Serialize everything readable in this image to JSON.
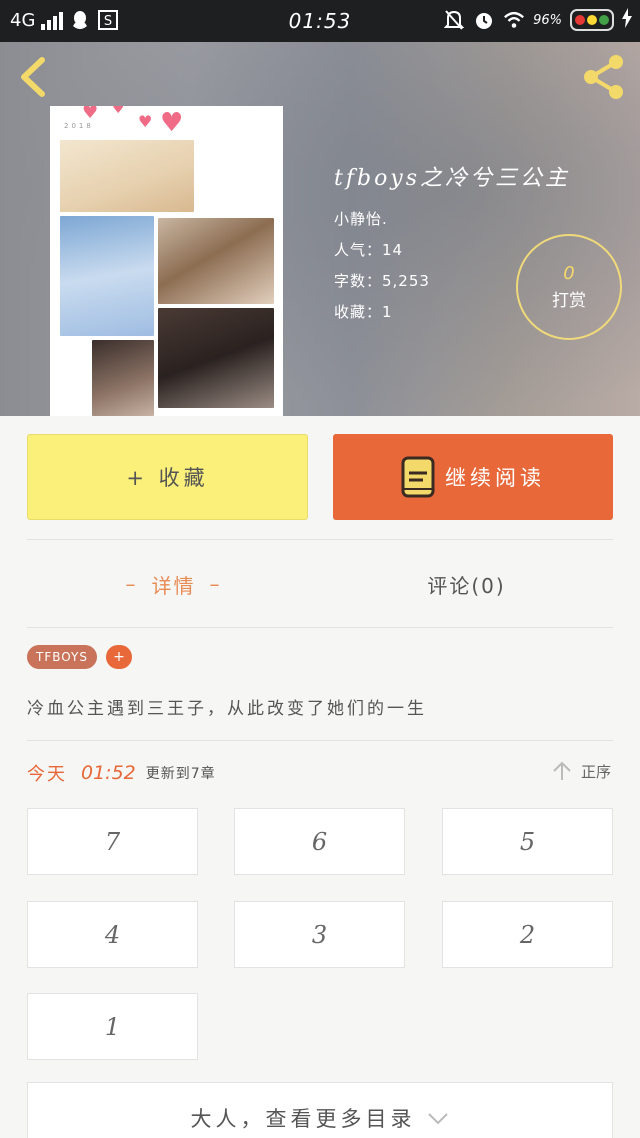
{
  "status_bar": {
    "network": "4G",
    "time": "01:53",
    "battery": "96%",
    "icons": [
      "signal-icon",
      "qq-icon",
      "s-app-icon",
      "mute-icon",
      "alarm-icon",
      "wifi-icon",
      "battery-icon",
      "charging-icon"
    ]
  },
  "header": {
    "back_icon": "chevron-left-icon",
    "share_icon": "share-icon"
  },
  "book": {
    "title": "tfboys之冷兮三公主",
    "author": "小静怡.",
    "popularity": "人气：14",
    "word_count": "字数：5,253",
    "favorites": "收藏：1",
    "cover_year": "2018"
  },
  "tip": {
    "count": "0",
    "label": "打赏"
  },
  "actions": {
    "collect_label": "+ 收藏",
    "read_label": "继续阅读"
  },
  "tabs": [
    {
      "label": "详情",
      "active": true
    },
    {
      "label": "评论(0)",
      "active": false
    }
  ],
  "tags": [
    "TFBOYS",
    "+"
  ],
  "description": "冷血公主遇到三王子，从此改变了她们的一生",
  "update": {
    "day": "今天",
    "time": "01:52",
    "text": "更新到7章",
    "order_label": "正序"
  },
  "chapters": [
    "7",
    "6",
    "5",
    "4",
    "3",
    "2",
    "1"
  ],
  "more_label": "大人，查看更多目录",
  "colors": {
    "accent_orange": "#e8683a",
    "collect_yellow": "#faf07a",
    "tip_gold": "#efd97a",
    "tag_brown": "#c9745a"
  }
}
